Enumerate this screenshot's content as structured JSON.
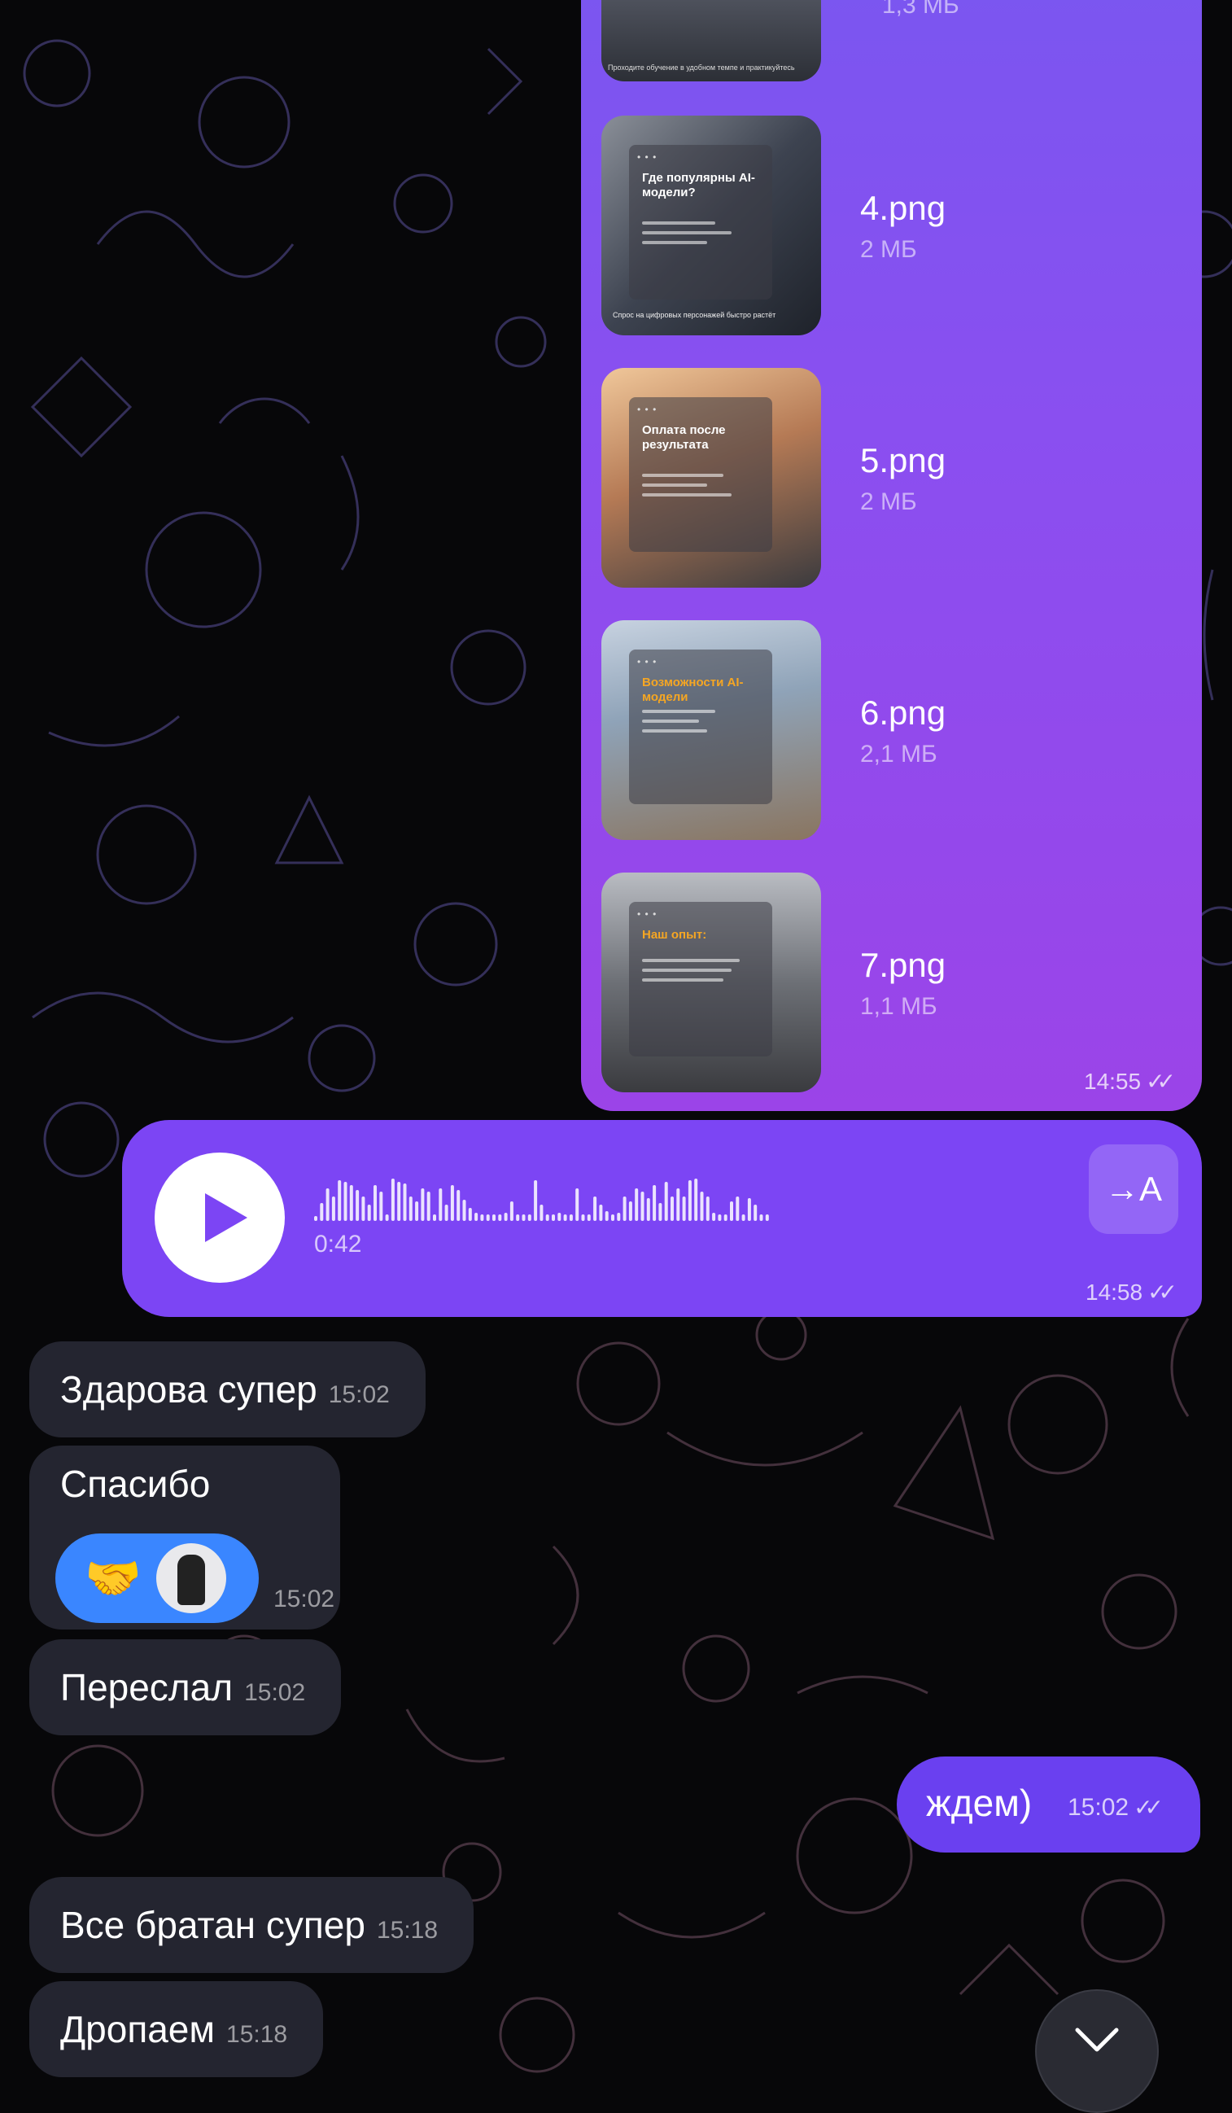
{
  "album": {
    "top_partial_size": "1,3 МБ",
    "top_partial_caption": "Проходите обучение в удобном темпе и практикуйтесь",
    "files": [
      {
        "name": "4.png",
        "size": "2 МБ",
        "thumb_title": "Где популярны AI-модели?",
        "thumb_footer": "Спрос на цифровых персонажей быстро растёт"
      },
      {
        "name": "5.png",
        "size": "2 МБ",
        "thumb_title": "Оплата после результата",
        "thumb_footer": ""
      },
      {
        "name": "6.png",
        "size": "2,1 МБ",
        "thumb_title": "Возможности AI-модели",
        "thumb_footer": ""
      },
      {
        "name": "7.png",
        "size": "1,1 МБ",
        "thumb_title": "Наш опыт:",
        "thumb_footer": ""
      }
    ],
    "time": "14:55"
  },
  "voice": {
    "duration": "0:42",
    "time": "14:58",
    "transcribe_label": "→A"
  },
  "messages": [
    {
      "text": "Здарова супер",
      "time": "15:02"
    },
    {
      "text": "Спасибо",
      "time": "15:02",
      "reaction_emoji": "🤝"
    },
    {
      "text": "Переслал",
      "time": "15:02"
    },
    {
      "text": "Все братан супер",
      "time": "15:18"
    },
    {
      "text": "Дропаем",
      "time": "15:18"
    }
  ],
  "outgoing": {
    "text": "ждем)",
    "time": "15:02"
  },
  "colors": {
    "background": "#070709",
    "outgoing_bubble": "#7c45f4",
    "incoming_bubble": "#242530",
    "reaction": "#3a86ff"
  },
  "icons": [
    "play-icon",
    "read-checks-icon",
    "transcribe-icon",
    "chevron-down-icon",
    "avatar"
  ]
}
